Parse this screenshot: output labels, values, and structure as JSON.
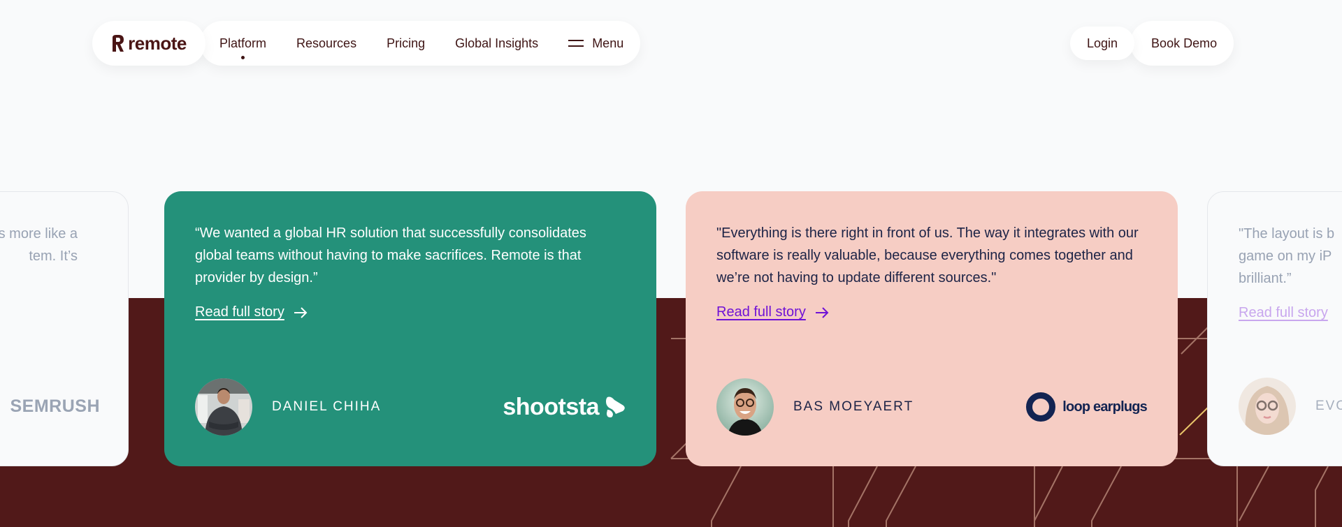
{
  "nav": {
    "brand": "remote",
    "links": [
      {
        "label": "Platform",
        "active": true
      },
      {
        "label": "Resources"
      },
      {
        "label": "Pricing"
      },
      {
        "label": "Global Insights"
      }
    ],
    "menu_label": "Menu",
    "login_label": "Login",
    "demo_label": "Book Demo"
  },
  "colors": {
    "brand": "#4a1515",
    "band": "#511919",
    "green_card": "#24917a",
    "pink_card": "#f6cdc4",
    "link_purple": "#6f11d6"
  },
  "testimonials": [
    {
      "quote_partial": "t’s more like a\ntem. It’s",
      "company": "SEMRUSH",
      "state": "faded"
    },
    {
      "quote": "“We wanted a global HR solution that successfully consolidates global teams without having to make sacrifices. Remote is that provider by design.”",
      "read_label": "Read full story",
      "name": "DANIEL CHIHA",
      "company": "shootsta"
    },
    {
      "quote": "\"Everything is there right in front of us. The way it integrates with our software is really valuable, because everything comes together and we’re not having to update different sources.\"",
      "read_label": "Read full story",
      "name": "BAS MOEYAERT",
      "company": "loop earplugs"
    },
    {
      "quote_partial": "\"The layout is b\ngame on my iP\nbrilliant.”",
      "read_label": "Read full story",
      "name_partial": "EVO",
      "state": "faded"
    }
  ]
}
